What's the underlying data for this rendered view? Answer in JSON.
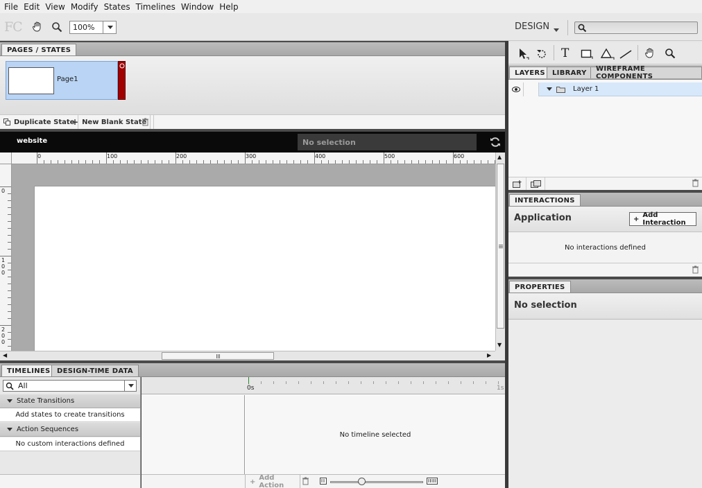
{
  "menu": [
    "File",
    "Edit",
    "View",
    "Modify",
    "States",
    "Timelines",
    "Window",
    "Help"
  ],
  "toolbar": {
    "logo": "FC",
    "zoom": "100%",
    "workspace": "DESIGN",
    "search_placeholder": ""
  },
  "pages_panel": {
    "tab": "PAGES / STATES",
    "state_name": "Page1",
    "duplicate_label": "Duplicate State",
    "new_blank_label": "New Blank State"
  },
  "canvas": {
    "title": "website",
    "selection": "No selection",
    "ruler_h_labels": [
      "0",
      "100",
      "200",
      "300",
      "400",
      "500",
      "600"
    ],
    "ruler_v_labels": [
      "0",
      "100",
      "200"
    ]
  },
  "timelines": {
    "tabs": [
      "TIMELINES",
      "DESIGN-TIME DATA"
    ],
    "filter": "All",
    "state_transitions": "State Transitions",
    "state_transitions_hint": "Add states to create transitions",
    "action_sequences": "Action Sequences",
    "action_sequences_hint": "No custom interactions defined",
    "time_start": "0s",
    "time_end": "1s",
    "no_timeline": "No timeline selected",
    "add_action": "Add Action"
  },
  "layers_panel": {
    "tabs": [
      "LAYERS",
      "LIBRARY",
      "WIREFRAME COMPONENTS"
    ],
    "layer_name": "Layer 1"
  },
  "interactions_panel": {
    "tab": "INTERACTIONS",
    "title": "Application",
    "add_label": "Add Interaction",
    "empty": "No interactions defined"
  },
  "properties_panel": {
    "tab": "PROPERTIES",
    "empty": "No selection"
  },
  "colors": {
    "state_selected": "#b9d4f4",
    "state_accent": "#a10000",
    "layer_selected": "#d7e8fb"
  }
}
